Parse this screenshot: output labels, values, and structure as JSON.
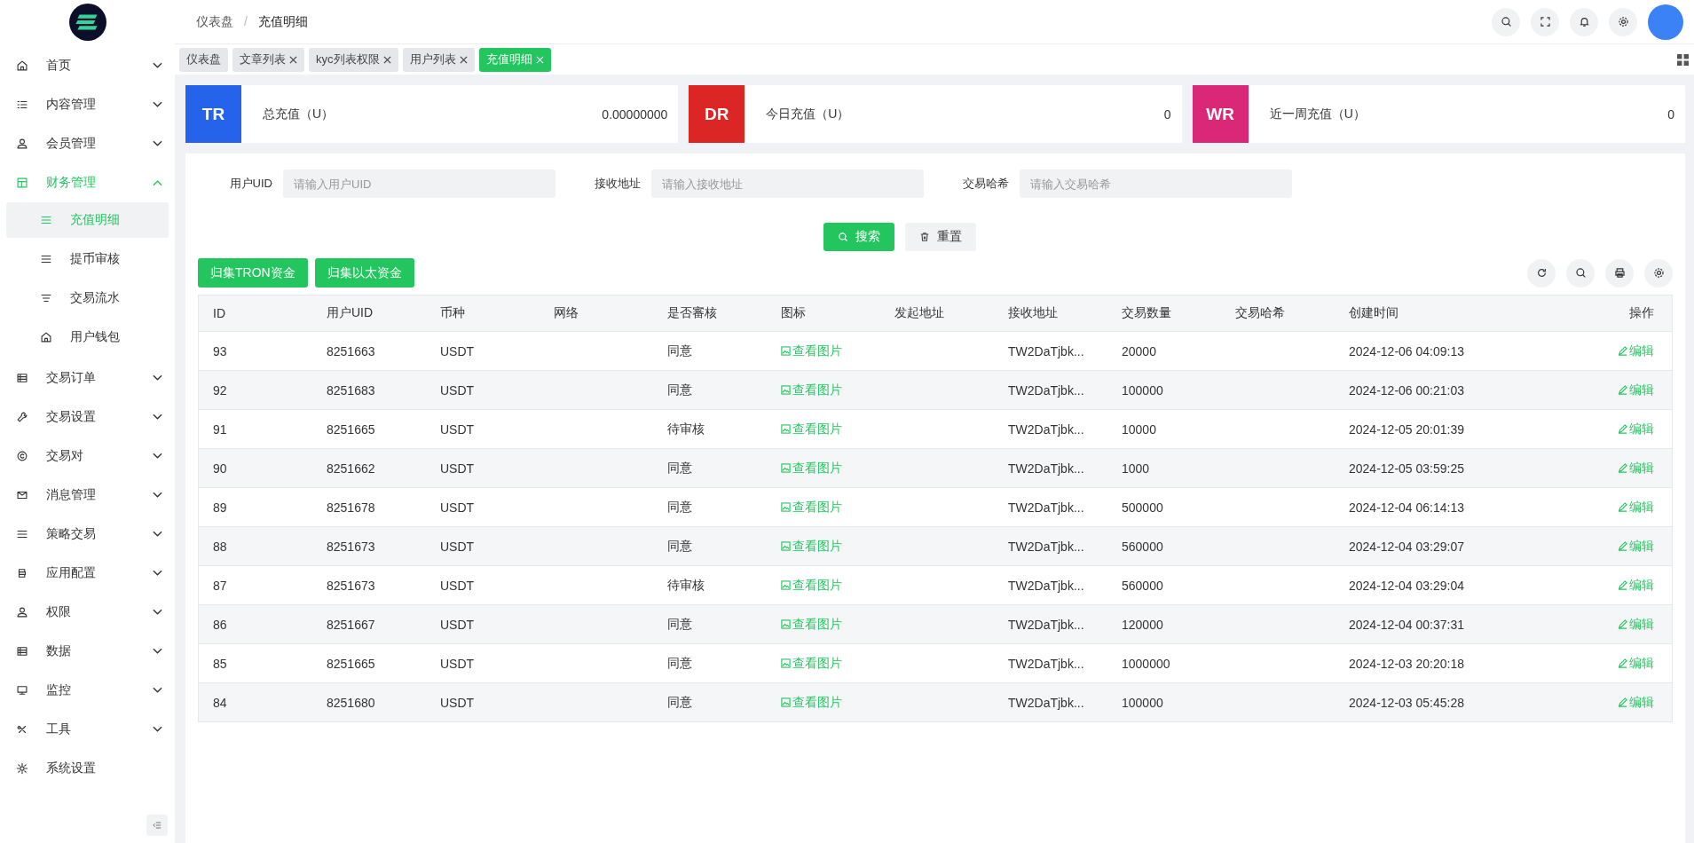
{
  "breadcrumb": [
    "仪表盘",
    "充值明细"
  ],
  "breadcrumb_separator": "/",
  "sidebar": {
    "items": [
      {
        "label": "首页",
        "expanded": false
      },
      {
        "label": "内容管理",
        "expanded": false
      },
      {
        "label": "会员管理",
        "expanded": false
      },
      {
        "label": "财务管理",
        "expanded": true,
        "children": [
          {
            "label": "充值明细",
            "selected": true
          },
          {
            "label": "提币审核",
            "selected": false
          },
          {
            "label": "交易流水",
            "selected": false
          },
          {
            "label": "用户钱包",
            "selected": false
          }
        ]
      },
      {
        "label": "交易订单",
        "expanded": false
      },
      {
        "label": "交易设置",
        "expanded": false
      },
      {
        "label": "交易对",
        "expanded": false
      },
      {
        "label": "消息管理",
        "expanded": false
      },
      {
        "label": "策略交易",
        "expanded": false
      },
      {
        "label": "应用配置",
        "expanded": false
      },
      {
        "label": "权限",
        "expanded": false
      },
      {
        "label": "数据",
        "expanded": false
      },
      {
        "label": "监控",
        "expanded": false
      },
      {
        "label": "工具",
        "expanded": false
      },
      {
        "label": "系统设置"
      }
    ]
  },
  "tabs": [
    {
      "label": "仪表盘",
      "closable": false,
      "selected": false
    },
    {
      "label": "文章列表",
      "closable": true,
      "selected": false
    },
    {
      "label": "kyc列表权限",
      "closable": true,
      "selected": false
    },
    {
      "label": "用户列表",
      "closable": true,
      "selected": false
    },
    {
      "label": "充值明细",
      "closable": true,
      "selected": true
    }
  ],
  "stats": [
    {
      "badge": "TR",
      "color": "#2563eb",
      "label": "总充值（U）",
      "value": "0.00000000"
    },
    {
      "badge": "DR",
      "color": "#dc2626",
      "label": "今日充值（U）",
      "value": "0"
    },
    {
      "badge": "WR",
      "color": "#db2777",
      "label": "近一周充值（U）",
      "value": "0"
    }
  ],
  "filters": [
    {
      "label": "用户UID",
      "placeholder": "请输入用户UID"
    },
    {
      "label": "接收地址",
      "placeholder": "请输入接收地址"
    },
    {
      "label": "交易哈希",
      "placeholder": "请输入交易哈希"
    }
  ],
  "search_button": "搜索",
  "reset_button": "重置",
  "actions": [
    "归集TRON资金",
    "归集以太资金"
  ],
  "table": {
    "columns": [
      "ID",
      "用户UID",
      "币种",
      "网络",
      "是否審核",
      "图标",
      "发起地址",
      "接收地址",
      "交易数量",
      "交易哈希",
      "创建时间",
      "操作"
    ],
    "rows": [
      {
        "id": "93",
        "uid": "8251663",
        "coin": "USDT",
        "review": "同意",
        "image_link": "查看图片",
        "to_address": "TW2DaTjbk...",
        "amount": "20000",
        "created": "2024-12-06 04:09:13",
        "action": "编辑"
      },
      {
        "id": "92",
        "uid": "8251683",
        "coin": "USDT",
        "review": "同意",
        "image_link": "查看图片",
        "to_address": "TW2DaTjbk...",
        "amount": "100000",
        "created": "2024-12-06 00:21:03",
        "action": "编辑"
      },
      {
        "id": "91",
        "uid": "8251665",
        "coin": "USDT",
        "review": "待审核",
        "image_link": "查看图片",
        "to_address": "TW2DaTjbk...",
        "amount": "10000",
        "created": "2024-12-05 20:01:39",
        "action": "编辑"
      },
      {
        "id": "90",
        "uid": "8251662",
        "coin": "USDT",
        "review": "同意",
        "image_link": "查看图片",
        "to_address": "TW2DaTjbk...",
        "amount": "1000",
        "created": "2024-12-05 03:59:25",
        "action": "编辑"
      },
      {
        "id": "89",
        "uid": "8251678",
        "coin": "USDT",
        "review": "同意",
        "image_link": "查看图片",
        "to_address": "TW2DaTjbk...",
        "amount": "500000",
        "created": "2024-12-04 06:14:13",
        "action": "编辑"
      },
      {
        "id": "88",
        "uid": "8251673",
        "coin": "USDT",
        "review": "同意",
        "image_link": "查看图片",
        "to_address": "TW2DaTjbk...",
        "amount": "560000",
        "created": "2024-12-04 03:29:07",
        "action": "编辑"
      },
      {
        "id": "87",
        "uid": "8251673",
        "coin": "USDT",
        "review": "待审核",
        "image_link": "查看图片",
        "to_address": "TW2DaTjbk...",
        "amount": "560000",
        "created": "2024-12-04 03:29:04",
        "action": "编辑"
      },
      {
        "id": "86",
        "uid": "8251667",
        "coin": "USDT",
        "review": "同意",
        "image_link": "查看图片",
        "to_address": "TW2DaTjbk...",
        "amount": "120000",
        "created": "2024-12-04 00:37:31",
        "action": "编辑"
      },
      {
        "id": "85",
        "uid": "8251665",
        "coin": "USDT",
        "review": "同意",
        "image_link": "查看图片",
        "to_address": "TW2DaTjbk...",
        "amount": "1000000",
        "created": "2024-12-03 20:20:18",
        "action": "编辑"
      },
      {
        "id": "84",
        "uid": "8251680",
        "coin": "USDT",
        "review": "同意",
        "image_link": "查看图片",
        "to_address": "TW2DaTjbk...",
        "amount": "100000",
        "created": "2024-12-03 05:45:28",
        "action": "编辑"
      }
    ]
  }
}
